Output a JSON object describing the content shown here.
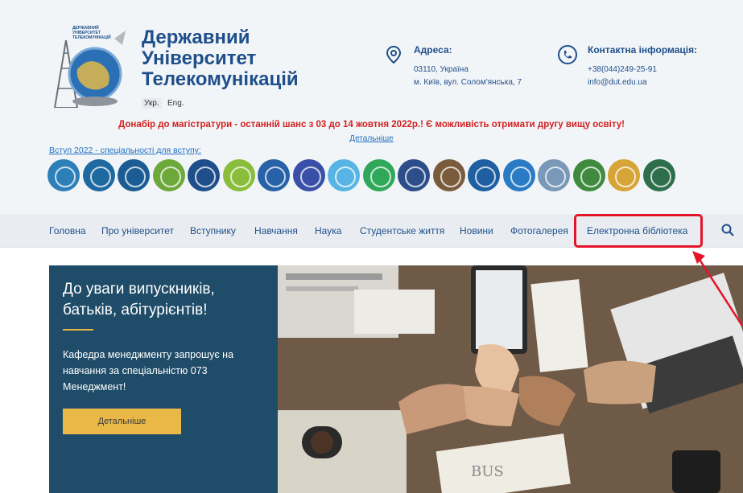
{
  "header": {
    "logo_text": [
      "ДЕРЖАВНИЙ",
      "УНІВЕРСИТЕТ",
      "ТЕЛЕКОМУНІКАЦІЙ"
    ],
    "title_lines": [
      "Державний",
      "Університет",
      "Телекомунікацій"
    ],
    "lang_ukr": "Укр.",
    "lang_eng": "Eng.",
    "address": {
      "icon": "location-icon",
      "heading": "Адреса:",
      "line1": "03110, Україна",
      "line2": "м. Київ, вул. Солом'янська, 7"
    },
    "contacts": {
      "icon": "phone-icon",
      "heading": "Контактна інформація:",
      "phone": "+38(044)249-25-91",
      "email": "info@dut.edu.ua"
    }
  },
  "announcement": {
    "text": "Донабір до магістратури - останній шанс з 03 до 14 жовтня 2022р.! Є можливість отримати другу вищу освіту!",
    "more": "Детальніше"
  },
  "admission": {
    "label": "Вступ 2022 - спеціальності для вступу:",
    "specialty_colors": [
      "#2d7fb8",
      "#1e6aa0",
      "#1a5c93",
      "#6da83a",
      "#1f4f8a",
      "#8bbd3c",
      "#2762a8",
      "#3a4fa8",
      "#58b4e4",
      "#2fa85a",
      "#2c4e8a",
      "#7a5b3c",
      "#1f5ea0",
      "#2a7bc4",
      "#7a98b8",
      "#3f8a3f",
      "#d6a437",
      "#2e6e4a"
    ]
  },
  "nav": {
    "items": [
      "Головна",
      "Про університет",
      "Вступнику",
      "Навчання",
      "Наука",
      "Студентське життя",
      "Новини",
      "Фотогалерея",
      "Електронна бібліотека"
    ],
    "search_icon": "search-icon",
    "highlight_color": "#e3142a"
  },
  "hero": {
    "title": "До уваги випускників, батьків, абітурієнтів!",
    "text": "Кафедра менеджменту запрошує на навчання за спеціальністю 073 Менеджмент!",
    "button": "Детальніше",
    "photo_sign": "BUS"
  },
  "colors": {
    "brand": "#1f4f8a",
    "accent": "#e9b847",
    "alert": "#d31f1f",
    "hero_bg": "#1f4c68"
  }
}
